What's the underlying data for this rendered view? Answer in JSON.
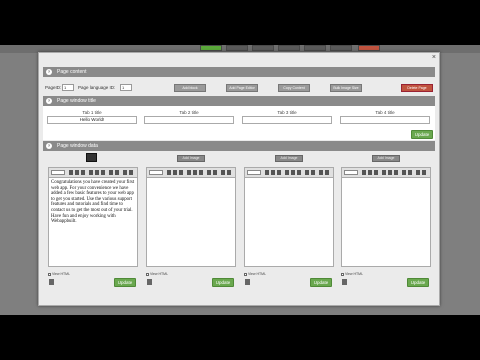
{
  "topbar": {
    "brand": ""
  },
  "modal": {
    "close": "×",
    "page_content_header": "Page content",
    "lang_row": {
      "page_id_label": "PageID:",
      "page_id_value": "1",
      "lang_label": "Page language ID:",
      "lang_value": "1",
      "buttons": [
        "Add block",
        "Add Page Editor",
        "Copy Content",
        "Bulk Image Size",
        "Delete Page"
      ]
    },
    "window_title_header": "Page window title",
    "tabs": [
      {
        "label": "Tab 1 title",
        "value": "Hello World!"
      },
      {
        "label": "Tab 2 title",
        "value": ""
      },
      {
        "label": "Tab 3 title",
        "value": ""
      },
      {
        "label": "Tab 4 title",
        "value": ""
      }
    ],
    "update_label": "Update",
    "window_data_header": "Page window data",
    "editors": [
      {
        "header_btn": "",
        "content": "Congratulations you have created your first web app. For your convenience we have added a few basic features to your web app to get you started. Use the various support features and tutorials and find time to contact us to get the most out of your trial. Have fun and enjoy working with Webappbuilt.",
        "view_html": "View HTML",
        "update": "Update"
      },
      {
        "header_btn": "Add Image",
        "content": "",
        "view_html": "View HTML",
        "update": "Update"
      },
      {
        "header_btn": "Add Image",
        "content": "",
        "view_html": "View HTML",
        "update": "Update"
      },
      {
        "header_btn": "Add Image",
        "content": "",
        "view_html": "View HTML",
        "update": "Update"
      }
    ]
  },
  "colors": {
    "accent_green": "#6aa84f",
    "danger_red": "#c0533e",
    "header_gray": "#8a8a8a"
  }
}
